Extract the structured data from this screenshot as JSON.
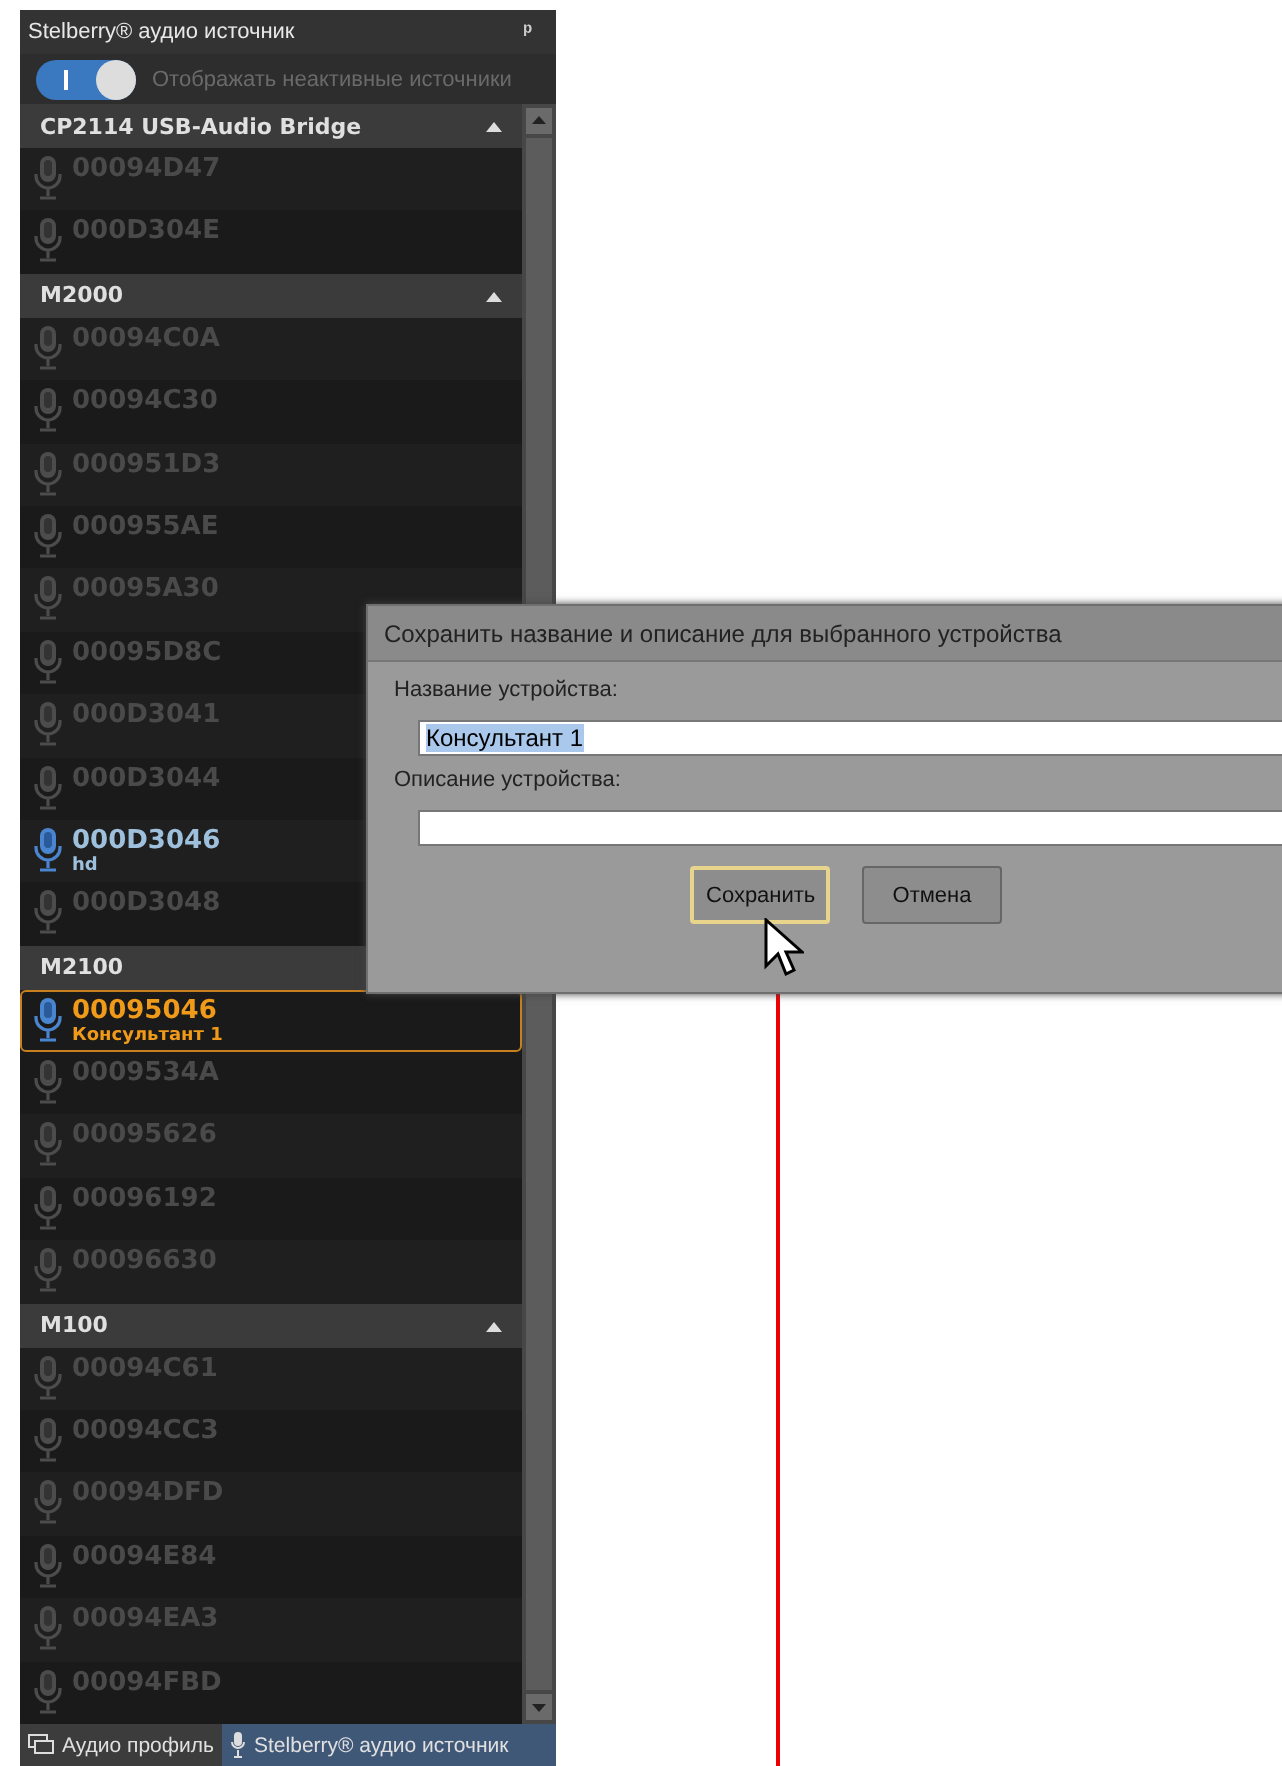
{
  "panel": {
    "title": "Stelberry® аудио источник",
    "pin": "ᵖ",
    "toggle": {
      "on": true,
      "label": "Отображать неактивные источники"
    },
    "groups": [
      {
        "name": "CP2114 USB-Audio Bridge",
        "caret_shown": true,
        "items": [
          {
            "id": "00094D47",
            "active": false,
            "selected": false
          },
          {
            "id": "000D304E",
            "active": false,
            "selected": false
          }
        ]
      },
      {
        "name": "M2000",
        "caret_shown": true,
        "items": [
          {
            "id": "00094C0A",
            "active": false,
            "selected": false
          },
          {
            "id": "00094C30",
            "active": false,
            "selected": false
          },
          {
            "id": "000951D3",
            "active": false,
            "selected": false
          },
          {
            "id": "000955AE",
            "active": false,
            "selected": false
          },
          {
            "id": "00095A30",
            "active": false,
            "selected": false
          },
          {
            "id": "00095D8C",
            "active": false,
            "selected": false
          },
          {
            "id": "000D3041",
            "active": false,
            "selected": false
          },
          {
            "id": "000D3044",
            "active": false,
            "selected": false
          },
          {
            "id": "000D3046",
            "subtitle": "hd",
            "active": true,
            "selected": false
          },
          {
            "id": "000D3048",
            "active": false,
            "selected": false
          }
        ]
      },
      {
        "name": "M2100",
        "caret_shown": false,
        "items": [
          {
            "id": "00095046",
            "subtitle": "Консультант 1",
            "active": true,
            "selected": true
          },
          {
            "id": "0009534A",
            "active": false,
            "selected": false
          },
          {
            "id": "00095626",
            "active": false,
            "selected": false
          },
          {
            "id": "00096192",
            "active": false,
            "selected": false
          },
          {
            "id": "00096630",
            "active": false,
            "selected": false
          }
        ]
      },
      {
        "name": "M100",
        "caret_shown": true,
        "items": [
          {
            "id": "00094C61",
            "active": false,
            "selected": false
          },
          {
            "id": "00094CC3",
            "active": false,
            "selected": false
          },
          {
            "id": "00094DFD",
            "active": false,
            "selected": false
          },
          {
            "id": "00094E84",
            "active": false,
            "selected": false
          },
          {
            "id": "00094EA3",
            "active": false,
            "selected": false
          },
          {
            "id": "00094FBD",
            "active": false,
            "selected": false
          }
        ]
      }
    ],
    "tabs": [
      {
        "label": "Аудио профиль",
        "kind": "profile",
        "selected": false
      },
      {
        "label": "Stelberry® аудио источник",
        "kind": "source",
        "selected": true
      }
    ]
  },
  "dialog": {
    "title": "Сохранить название и описание для выбранного устройства",
    "fields": [
      {
        "label": "Название устройства:",
        "value": "Консультант 1",
        "text_selected": true
      },
      {
        "label": "Описание устройства:"
      }
    ],
    "buttons": [
      {
        "label": "Сохранить",
        "focused": true
      },
      {
        "label": "Отмена",
        "focused": false
      }
    ]
  }
}
